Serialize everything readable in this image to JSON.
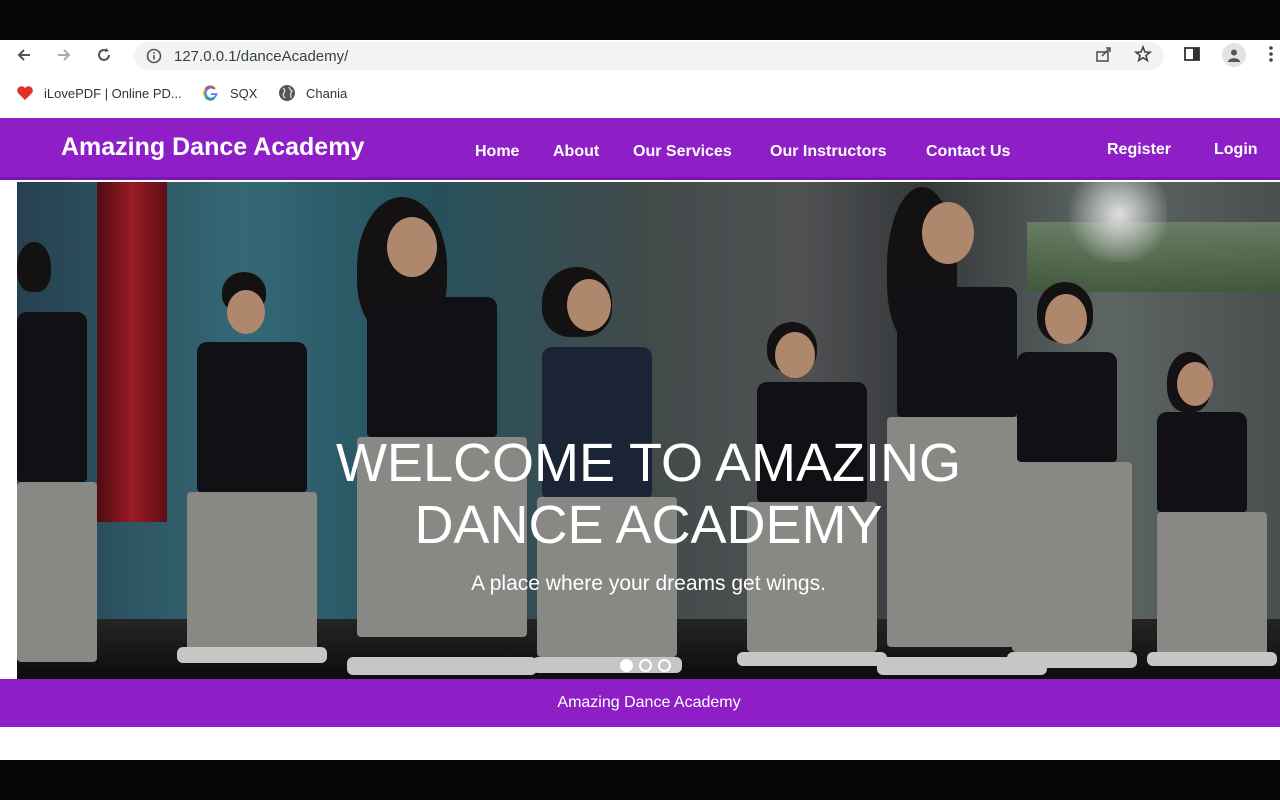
{
  "browser": {
    "url": "127.0.0.1/danceAcademy/",
    "bookmarks": [
      {
        "label": "iLovePDF | Online PD...",
        "icon": "heart-icon"
      },
      {
        "label": "SQX",
        "icon": "google-icon"
      },
      {
        "label": "Chania",
        "icon": "globe-icon"
      }
    ]
  },
  "navbar": {
    "brand": "Amazing Dance Academy",
    "links": [
      "Home",
      "About",
      "Our Services",
      "Our Instructors",
      "Contact Us"
    ],
    "register": "Register",
    "login": "Login",
    "color": "#8e1fc6"
  },
  "hero": {
    "title_line1": "WELCOME TO AMAZING",
    "title_line2": "DANCE ACADEMY",
    "subtitle": "A place where your dreams get wings.",
    "slides": 3,
    "active_slide": 1
  },
  "footer": {
    "text": "Amazing Dance Academy"
  }
}
